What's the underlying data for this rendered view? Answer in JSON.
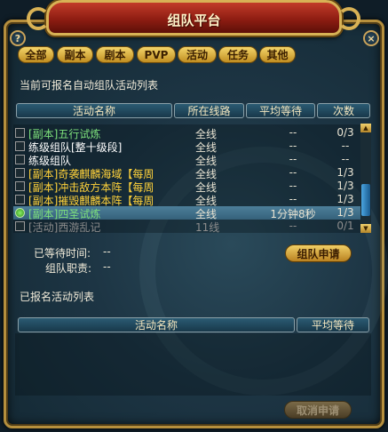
{
  "window": {
    "title": "组队平台",
    "help": "?",
    "close": "×"
  },
  "tabs": [
    "全部",
    "副本",
    "剧本",
    "PVP",
    "活动",
    "任务",
    "其他"
  ],
  "available_list": {
    "heading": "当前可报名自动组队活动列表",
    "columns": [
      "活动名称",
      "所在线路",
      "平均等待",
      "次数"
    ],
    "rows": [
      {
        "name": "[副本]五行试炼",
        "line": "全线",
        "wait": "--",
        "count": "0/3",
        "style": "green"
      },
      {
        "name": "练级组队[整十级段]",
        "line": "全线",
        "wait": "--",
        "count": "--",
        "style": "white"
      },
      {
        "name": "练级组队",
        "line": "全线",
        "wait": "--",
        "count": "--",
        "style": "white"
      },
      {
        "name": "[副本]奇袭麒麟海域【每周",
        "line": "全线",
        "wait": "--",
        "count": "1/3",
        "style": "yellow"
      },
      {
        "name": "[副本]冲击敌方本阵【每周",
        "line": "全线",
        "wait": "--",
        "count": "1/3",
        "style": "yellow"
      },
      {
        "name": "[副本]摧毁麒麟本阵【每周",
        "line": "全线",
        "wait": "--",
        "count": "1/3",
        "style": "yellow"
      },
      {
        "name": "[副本]四圣试炼",
        "line": "全线",
        "wait": "1分钟8秒",
        "count": "1/3",
        "style": "green",
        "selected": true
      },
      {
        "name": "[活动]西游乱记",
        "line": "11线",
        "wait": "--",
        "count": "0/1",
        "style": "gray"
      }
    ]
  },
  "status": {
    "waited_label": "已等待时间:",
    "waited_value": "--",
    "role_label": "组队职责:",
    "role_value": "--",
    "apply_button": "组队申请"
  },
  "registered_list": {
    "heading": "已报名活动列表",
    "columns": [
      "活动名称",
      "平均等待"
    ]
  },
  "cancel_button": "取消申请",
  "scrollbar": {
    "up": "▲",
    "down": "▼"
  }
}
